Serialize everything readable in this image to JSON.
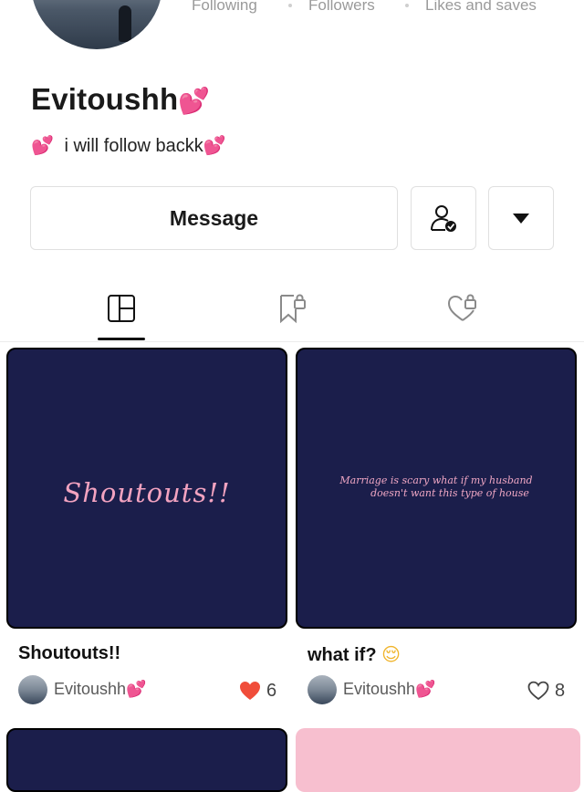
{
  "profile": {
    "stats": {
      "following": "Following",
      "followers": "Followers",
      "likes_saves": "Likes and saves"
    },
    "name": "Evitoushh",
    "name_emoji": "💕",
    "bio_emoji_start": "💕",
    "bio": "i will follow backk",
    "bio_emoji_end": "💕"
  },
  "actions": {
    "message": "Message"
  },
  "tabs": [
    "posts-grid-icon",
    "saved-locked-icon",
    "liked-locked-icon"
  ],
  "posts": [
    {
      "image_text": "Shoutouts!!",
      "title": "Shoutouts!!",
      "title_emoji": "",
      "author": "Evitoushh",
      "author_emoji": "💕",
      "likes": "6",
      "liked": true
    },
    {
      "image_text_line1": "Marriage is scary what if my husband",
      "image_text_line2": "doesn't want this type of house",
      "title": "what if?",
      "title_emoji": "😌",
      "author": "Evitoushh",
      "author_emoji": "💕",
      "likes": "8",
      "liked": false
    }
  ],
  "colors": {
    "card_bg": "#1b1e4b",
    "card_text": "#f3a3c0",
    "liked_heart": "#f04d3a",
    "emoji_pink": "#ef4ba6"
  }
}
